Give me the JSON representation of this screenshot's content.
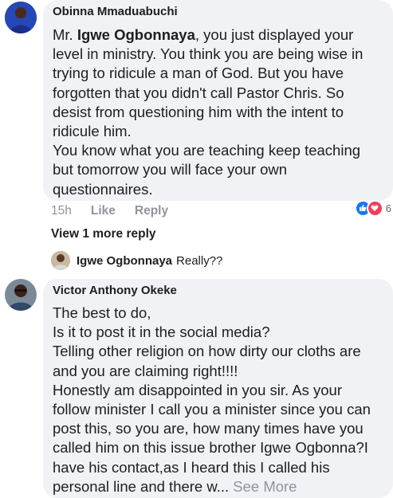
{
  "comment1": {
    "author": "Obinna Mmaduabuchi",
    "lines": [
      [
        "Mr. ",
        "Igwe Ogbonnaya",
        ", you just displayed your"
      ],
      "level in ministry. You think you are being wise in",
      "trying to ridicule a man of God. But you have",
      "forgotten that you didn't call Pastor Chris. So",
      "desist from questioning him with the intent to",
      "ridicule him.",
      "You know what you are teaching keep teaching",
      "but tomorrow you will face your own",
      "questionnaires."
    ],
    "time": "15h",
    "like_label": "Like",
    "reply_label": "Reply",
    "reaction_count": "6",
    "reaction_icons": [
      "like-icon",
      "love-icon"
    ],
    "like_color": "#1877f2",
    "love_color": "#f33e58"
  },
  "more_replies_label": "View 1 more reply",
  "reply_preview": {
    "author": "Igwe Ogbonnaya",
    "text": "Really??"
  },
  "comment2": {
    "author": "Victor Anthony Okeke",
    "lines": [
      "The best to do,",
      "Is it to post it in the social media?",
      "Telling other religion on how dirty our cloths are",
      "and you are claiming right!!!!",
      "Honestly am disappointed in you sir. As your",
      "follow minister I call you a minister since you can",
      "post this, so you are,  how many times have you",
      "called him on this issue brother Igwe Ogbonna?I",
      "have his contact,as I heard this I called his"
    ],
    "last_line": "personal line and there w...",
    "see_more": "See More"
  }
}
